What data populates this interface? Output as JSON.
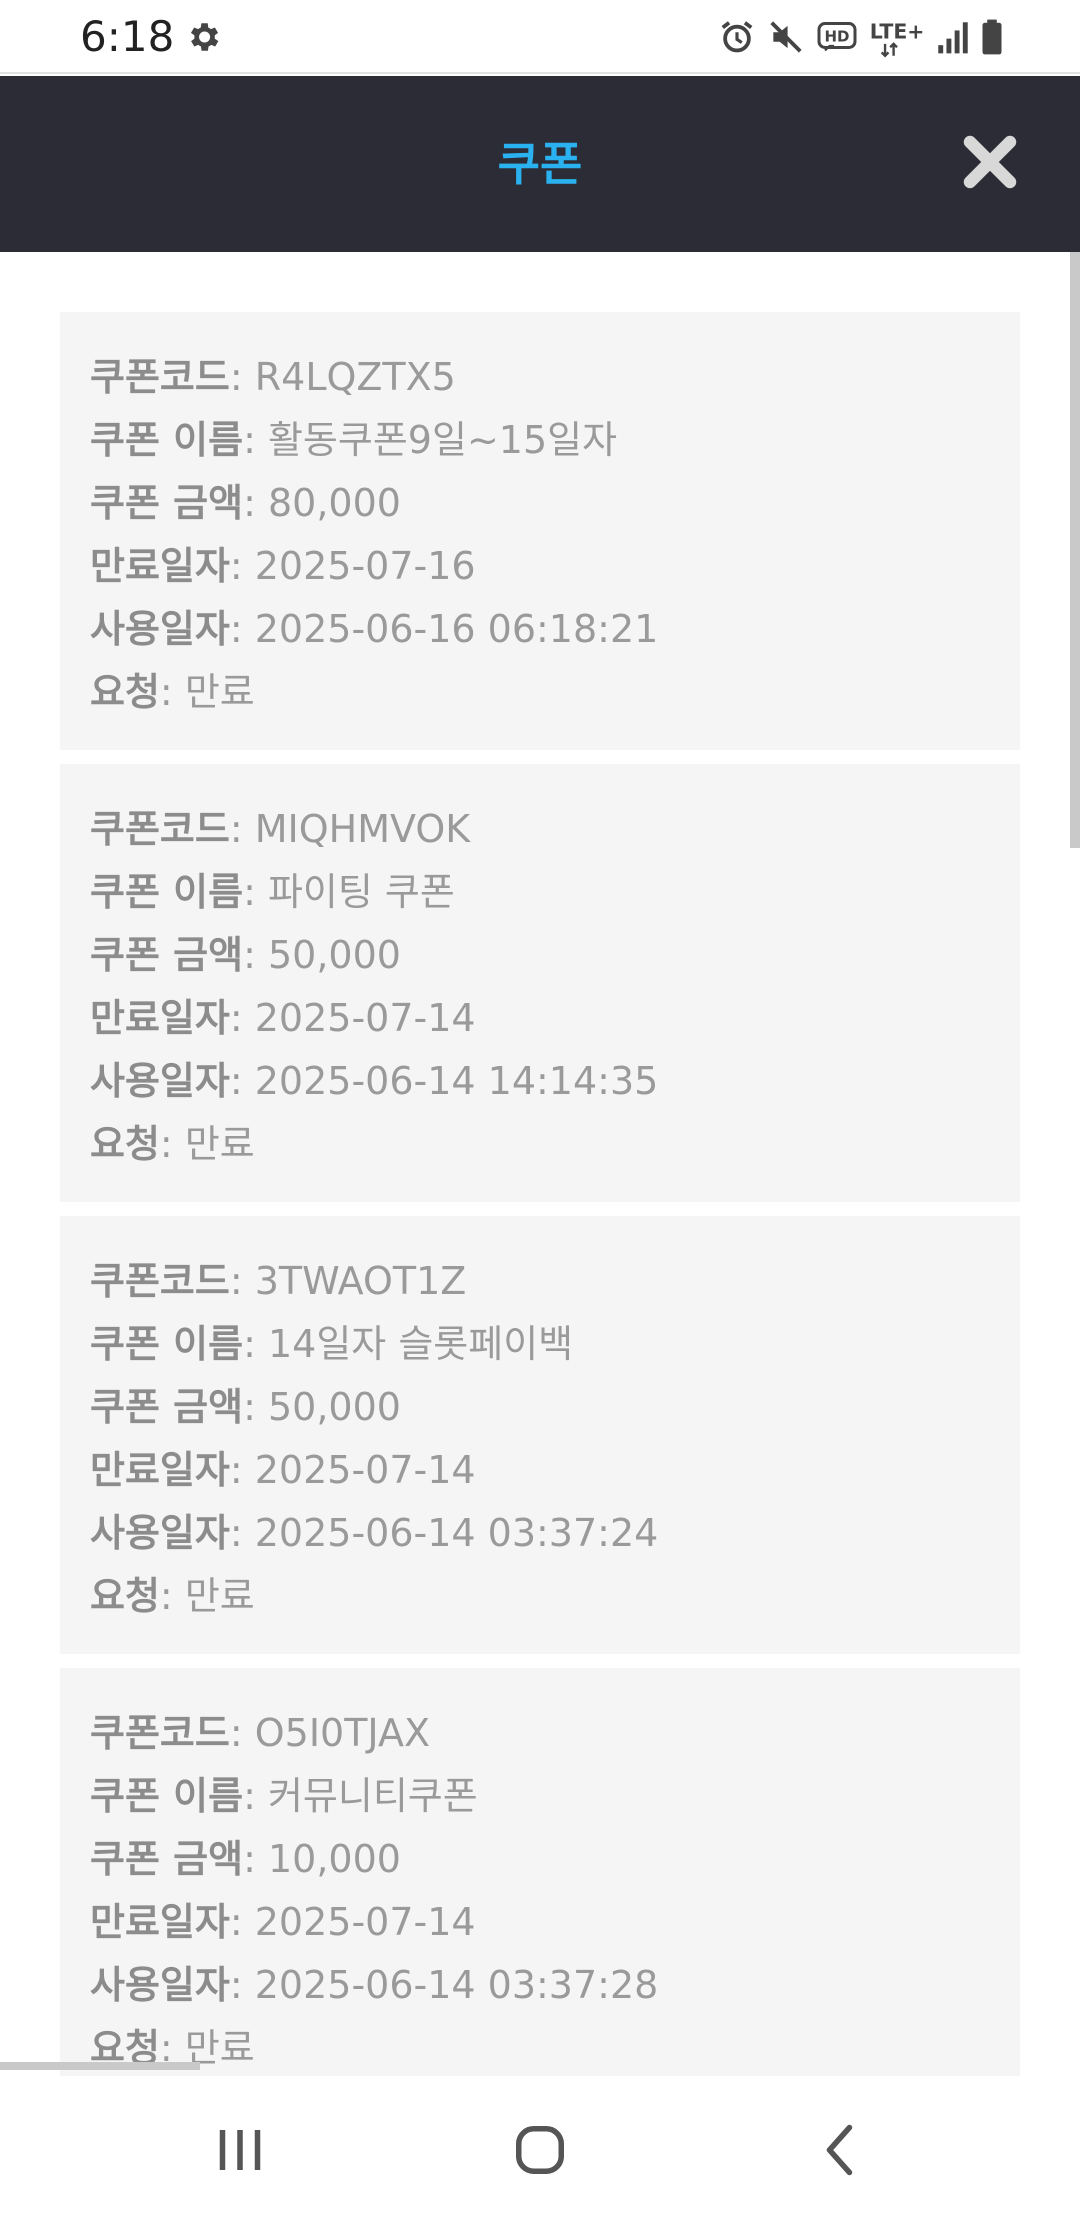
{
  "status_bar": {
    "time": "6:18",
    "icons": [
      "gear-icon",
      "alarm-icon",
      "mute-icon",
      "hd-icon",
      "lte-icon",
      "signal-icon",
      "battery-icon"
    ],
    "hd_text": "HD",
    "lte_text": "LTE+"
  },
  "header": {
    "title": "쿠폰",
    "title_color": "#2ab2f0",
    "background": "#2c2c36"
  },
  "labels": {
    "code": "쿠폰코드",
    "name": "쿠폰 이름",
    "amount": "쿠폰 금액",
    "expire": "만료일자",
    "used": "사용일자",
    "request": "요청"
  },
  "coupons": [
    {
      "code": "R4LQZTX5",
      "name": "활동쿠폰9일~15일자",
      "amount": "80,000",
      "expire": "2025-07-16",
      "used": "2025-06-16 06:18:21",
      "request": "만료"
    },
    {
      "code": "MIQHMVOK",
      "name": "파이팅 쿠폰",
      "amount": "50,000",
      "expire": "2025-07-14",
      "used": "2025-06-14 14:14:35",
      "request": "만료"
    },
    {
      "code": "3TWAOT1Z",
      "name": "14일자 슬롯페이백",
      "amount": "50,000",
      "expire": "2025-07-14",
      "used": "2025-06-14 03:37:24",
      "request": "만료"
    },
    {
      "code": "O5I0TJAX",
      "name": "커뮤니티쿠폰",
      "amount": "10,000",
      "expire": "2025-07-14",
      "used": "2025-06-14 03:37:28",
      "request": "만료"
    }
  ],
  "nav_bar": {
    "icons": [
      "recent-apps-icon",
      "home-icon",
      "back-icon"
    ]
  }
}
